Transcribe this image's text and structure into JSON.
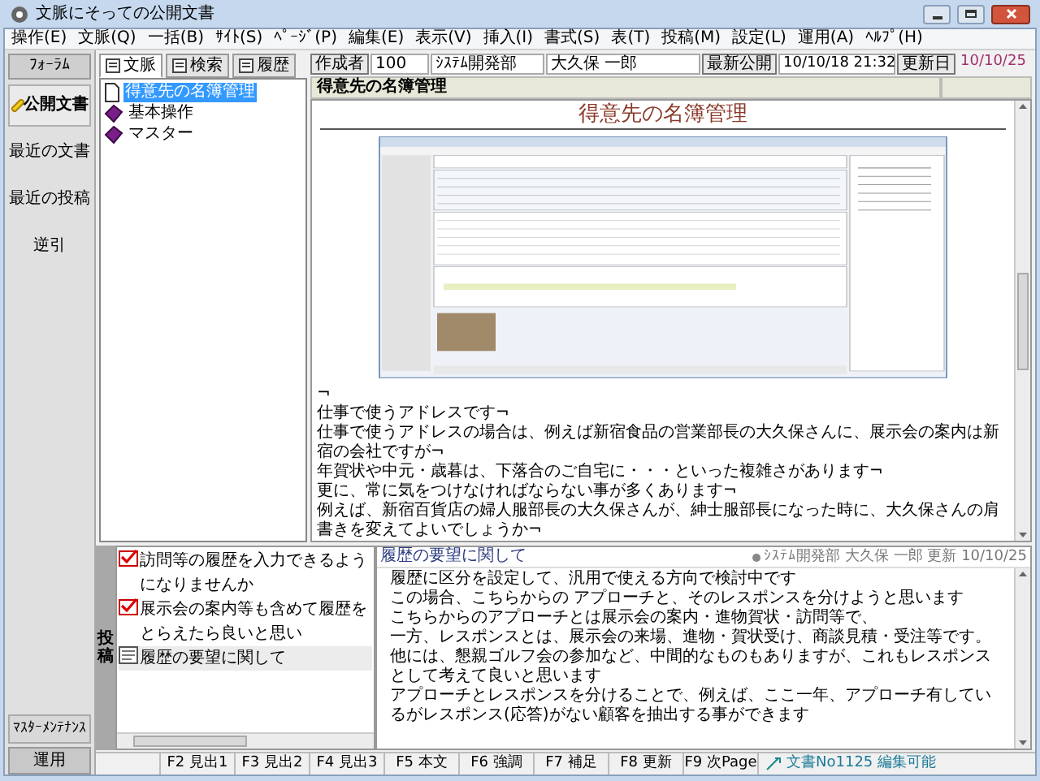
{
  "window": {
    "title": "文脈にそっての公開文書"
  },
  "menu": [
    "操作(E)",
    "文脈(Q)",
    "一括(B)",
    "ｻｲﾄ(S)",
    "ﾍﾟｰｼﾞ(P)",
    "編集(E)",
    "表示(V)",
    "挿入(I)",
    "書式(S)",
    "表(T)",
    "投稿(M)",
    "設定(L)",
    "運用(A)",
    "ﾍﾙﾌﾟ(H)"
  ],
  "nav": {
    "header": "ﾌｫｰﾗﾑ",
    "items": [
      {
        "label": "公開文書",
        "selected": true
      },
      {
        "label": "最近の文書",
        "selected": false
      },
      {
        "label": "最近の投稿",
        "selected": false
      },
      {
        "label": "逆引",
        "selected": false
      }
    ],
    "footer": [
      "ﾏｽﾀｰﾒﾝﾃﾅﾝｽ",
      "運用"
    ]
  },
  "tree_tabs": [
    {
      "label": "文脈",
      "selected": true
    },
    {
      "label": "検索",
      "selected": false
    },
    {
      "label": "履歴",
      "selected": false
    }
  ],
  "tree": [
    {
      "label": "得意先の名簿管理",
      "kind": "page",
      "selected": true
    },
    {
      "label": "基本操作",
      "kind": "book",
      "selected": false
    },
    {
      "label": "マスター",
      "kind": "book",
      "selected": false
    }
  ],
  "doc_header": {
    "author_label": "作成者",
    "code": "100",
    "department": "ｼｽﾃﾑ開発部",
    "author": "大久保 一郎",
    "published_label": "最新公開",
    "published": "10/10/18 21:32",
    "updated_label": "更新日",
    "updated": "10/10/25"
  },
  "doc_title": "得意先の名簿管理",
  "content": {
    "heading": "得意先の名簿管理",
    "paragraphs": [
      "¬",
      "仕事で使うアドレスです¬",
      "仕事で使うアドレスの場合は、例えば新宿食品の営業部長の大久保さんに、展示会の案内は新宿の会社ですが¬",
      "年賀状や中元・歳暮は、下落合のご自宅に・・・といった複雑さがあります¬",
      "更に、常に気をつけなければならない事が多くあります¬",
      "例えば、新宿百貨店の婦人服部長の大久保さんが、紳士服部長になった時に、大久保さんの肩書きを変えてよいでしょうか¬"
    ]
  },
  "posts": {
    "label": "投稿",
    "items": [
      {
        "title": "訪問等の履歴を入力できるようになりませんか",
        "kind": "reply",
        "selected": false
      },
      {
        "title": "展示会の案内等も含めて履歴をとらえたら良いと思い",
        "kind": "reply",
        "selected": false
      },
      {
        "title": "履歴の要望に関して",
        "kind": "topic",
        "selected": true
      }
    ]
  },
  "post_view": {
    "title": "履歴の要望に関して",
    "meta": "ｼｽﾃﾑ開発部 大久保 一郎 更新 10/10/25",
    "body": [
      "履歴に区分を設定して、汎用で使える方向で検討中です",
      "この場合、こちらからの アプローチと、そのレスポンスを分けようと思います",
      "こちらからのアプローチとは展示会の案内・進物賀状・訪問等で、",
      "一方、レスポンスとは、展示会の来場、進物・賀状受け、商談見積・受注等です。",
      "他には、懇親ゴルフ会の参加など、中間的なものもありますが、これもレスポンスとして考えて良いと思います",
      "アプローチとレスポンスを分けることで、例えば、ここ一年、アプローチ有しているがレスポンス(応答)がない顧客を抽出する事ができます"
    ]
  },
  "function_keys": [
    "F2 見出1",
    "F3 見出2",
    "F4 見出3",
    "F5 本文",
    "F6 強調",
    "F7 補足",
    "F8 更新",
    "F9 次Page"
  ],
  "status": "文書No1125 編集可能"
}
